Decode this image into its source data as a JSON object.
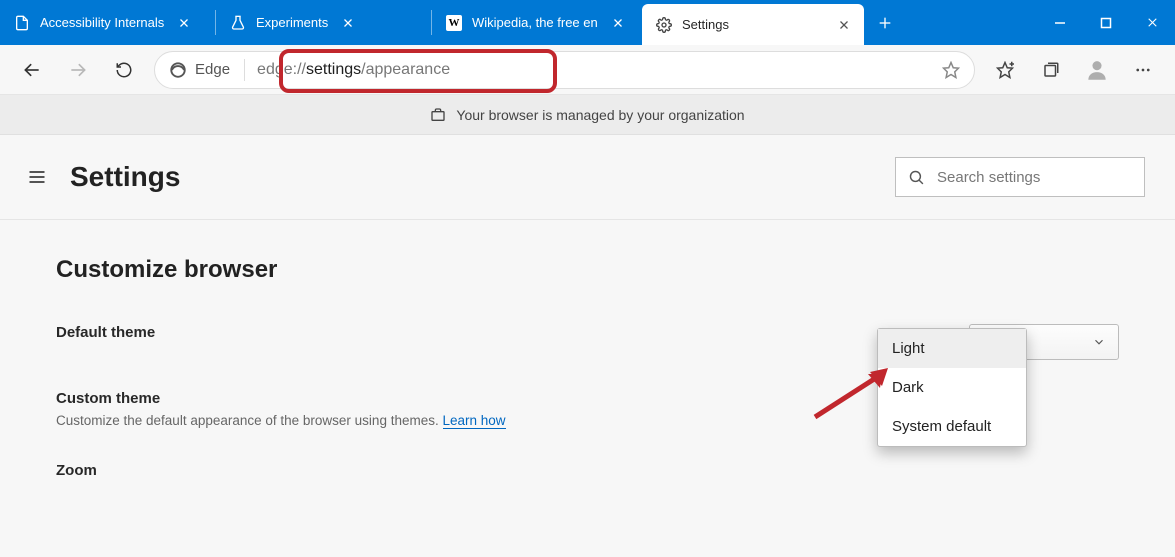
{
  "tabs": [
    {
      "label": "Accessibility Internals",
      "icon": "file-icon"
    },
    {
      "label": "Experiments",
      "icon": "flask-icon"
    },
    {
      "label": "Wikipedia, the free en",
      "icon": "wikipedia-icon"
    },
    {
      "label": "Settings",
      "icon": "gear-icon",
      "active": true
    }
  ],
  "omnibox": {
    "brand": "Edge",
    "protocol": "edge://",
    "segment": "settings",
    "path": "/appearance"
  },
  "managed_text": "Your browser is managed by your organization",
  "settings": {
    "title": "Settings",
    "search_placeholder": "Search settings",
    "section_title": "Customize browser",
    "default_theme_label": "Default theme",
    "custom_theme_label": "Custom theme",
    "custom_theme_sub": "Customize the default appearance of the browser using themes.",
    "learn_how": "Learn how",
    "zoom_label": "Zoom",
    "theme_selected": "Light",
    "theme_options": [
      "Light",
      "Dark",
      "System default"
    ]
  }
}
